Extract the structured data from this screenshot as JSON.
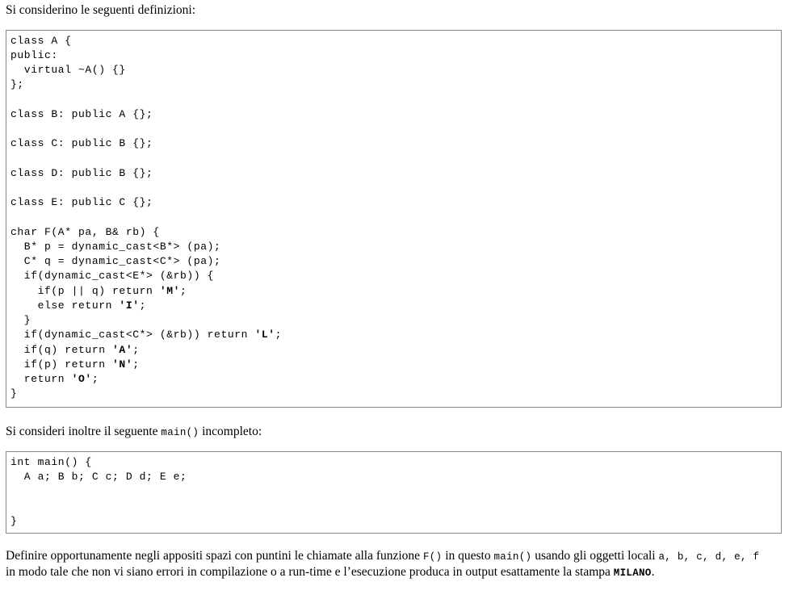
{
  "intro": "Si considerino le seguenti definizioni:",
  "definitions_code": [
    "class A {",
    "public:",
    "  virtual ~A() {}",
    "};",
    "",
    "class B: public A {};",
    "",
    "class C: public B {};",
    "",
    "class D: public B {};",
    "",
    "class E: public C {};",
    "",
    "char F(A* pa, B& rb) {",
    "  B* p = dynamic_cast<B*> (pa);",
    "  C* q = dynamic_cast<C*> (pa);",
    "  if(dynamic_cast<E*> (&rb)) {",
    "    if(p || q) return 'M';",
    "    else return 'I';",
    "  }",
    "  if(dynamic_cast<C*> (&rb)) return 'L';",
    "  if(q) return 'A';",
    "  if(p) return 'N';",
    "  return 'O';",
    "}"
  ],
  "main_intro": {
    "before": "Si consideri inoltre il seguente ",
    "code": "main()",
    "after": " incompleto:"
  },
  "main_code": [
    "int main() {",
    "  A a; B b; C c; D d; E e;",
    "",
    "",
    "}"
  ],
  "task": {
    "line1_a": "Definire opportunamente negli appositi spazi con puntini le chiamate alla funzione ",
    "line1_code1": "F()",
    "line1_b": " in questo ",
    "line1_code2": "main()",
    "line1_c": " usando gli oggetti locali ",
    "objects": "a, b, c, d, e, f",
    "line2_a": "in modo tale che non vi siano errori in compilazione o a run-time e l’esecuzione produca in output esattamente la stampa ",
    "output_word": "MILANO",
    "line2_b": "."
  }
}
